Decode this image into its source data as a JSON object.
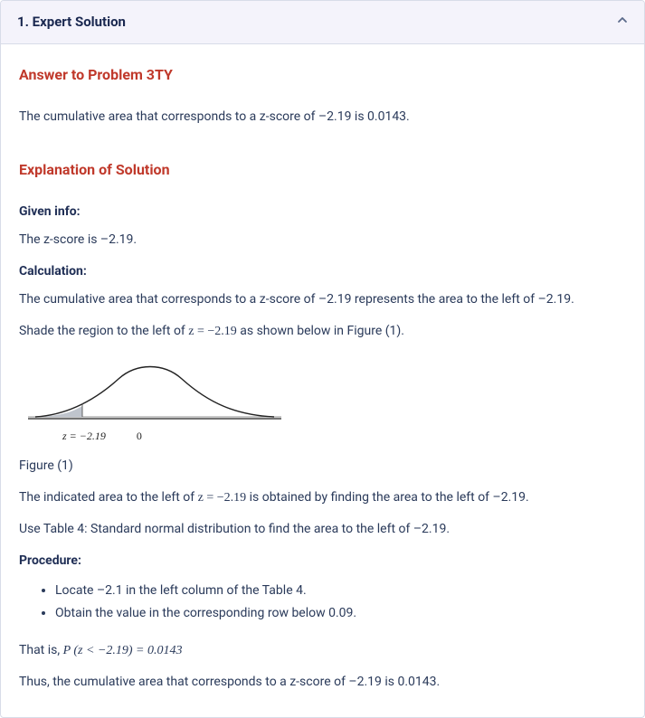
{
  "header": {
    "title": "1.  Expert Solution"
  },
  "answer": {
    "heading": "Answer to Problem 3TY",
    "text": "The cumulative area that corresponds to a z-score of –2.19 is 0.0143."
  },
  "explanation": {
    "heading": "Explanation of Solution",
    "given_label": "Given info:",
    "given_text": "The z-score is –2.19.",
    "calc_label": "Calculation:",
    "calc_p1": "The cumulative area that corresponds to a z-score of –2.19 represents the area to the left of –2.19.",
    "calc_p2_pre": "Shade the region to the left of ",
    "calc_p2_math": "z = −2.19",
    "calc_p2_post": " as shown below in Figure (1).",
    "figure_caption": "Figure (1)",
    "axis_left": "z = −2.19",
    "axis_zero": "0",
    "after_fig_pre": "The indicated area to the left of ",
    "after_fig_math": "z = −2.19",
    "after_fig_post": " is obtained by finding the area to the left of –2.19.",
    "use_table": "Use Table 4: Standard normal distribution to find the area to the left of –2.19.",
    "procedure_label": "Procedure:",
    "proc_items": [
      "Locate –2.1 in the left column of the Table 4.",
      "Obtain the value in the corresponding row below 0.09."
    ],
    "that_is_pre": "That is, ",
    "that_is_math": "P (z < −2.19) = 0.0143",
    "thus": "Thus, the cumulative area that corresponds to a z-score of –2.19 is 0.0143."
  }
}
